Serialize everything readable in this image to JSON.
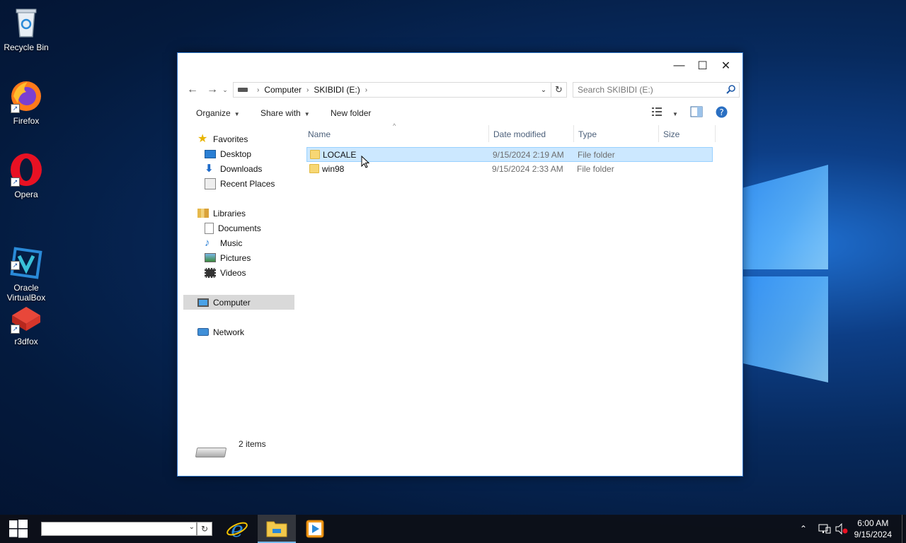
{
  "desktop": {
    "icons": [
      {
        "label": "Recycle Bin"
      },
      {
        "label": "Firefox"
      },
      {
        "label": "Opera"
      },
      {
        "label": "Oracle\nVirtualBox"
      },
      {
        "label": "r3dfox"
      }
    ]
  },
  "window": {
    "controls": {
      "minimize": "—",
      "maximize": "☐",
      "close": "✕"
    },
    "address": {
      "crumbs": [
        "Computer",
        "SKIBIDI (E:)"
      ]
    },
    "search_placeholder": "Search SKIBIDI (E:)",
    "toolbar": {
      "organize": "Organize",
      "share_with": "Share with",
      "new_folder": "New folder"
    },
    "nav": {
      "favorites": "Favorites",
      "desktop": "Desktop",
      "downloads": "Downloads",
      "recent_places": "Recent Places",
      "libraries": "Libraries",
      "documents": "Documents",
      "music": "Music",
      "pictures": "Pictures",
      "videos": "Videos",
      "computer": "Computer",
      "network": "Network"
    },
    "columns": {
      "name": "Name",
      "date_modified": "Date modified",
      "type": "Type",
      "size": "Size"
    },
    "files": [
      {
        "name": "LOCALE",
        "date": "9/15/2024 2:19 AM",
        "type": "File folder",
        "selected": true
      },
      {
        "name": "win98",
        "date": "9/15/2024 2:33 AM",
        "type": "File folder",
        "selected": false
      }
    ],
    "status": {
      "count": "2 items"
    }
  },
  "taskbar": {
    "time": "6:00 AM",
    "date": "9/15/2024",
    "apps": [
      "internet-explorer",
      "file-explorer",
      "media-player"
    ]
  },
  "colors": {
    "selection": "#cce8ff",
    "selection_border": "#99d1ff",
    "window_border": "#2b74c8",
    "taskbar": "#0c1018"
  }
}
